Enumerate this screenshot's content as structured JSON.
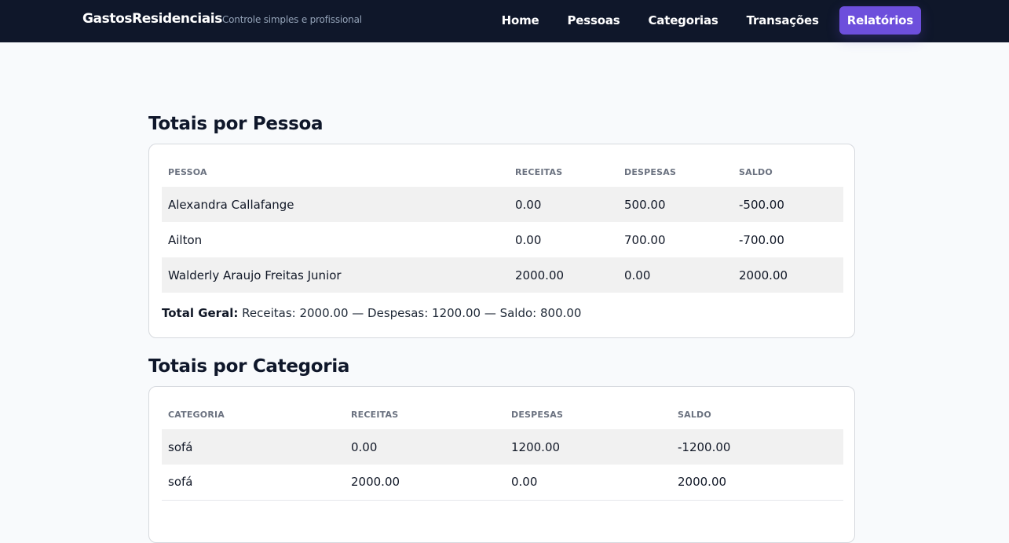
{
  "app": {
    "brand": "GastosResidenciais",
    "tagline": "Controle simples e profissional"
  },
  "nav": {
    "items": [
      {
        "label": "Home",
        "active": false
      },
      {
        "label": "Pessoas",
        "active": false
      },
      {
        "label": "Categorias",
        "active": false
      },
      {
        "label": "Transações",
        "active": false
      },
      {
        "label": "Relatórios",
        "active": true
      }
    ]
  },
  "colors": {
    "navbar_bg": "#0f172a",
    "accent": "#6d4fdc",
    "page_bg": "#f8fafc"
  },
  "pessoas": {
    "title": "Totais por Pessoa",
    "columns": [
      "PESSOA",
      "RECEITAS",
      "DESPESAS",
      "SALDO"
    ],
    "rows": [
      [
        "Alexandra Callafange",
        "0.00",
        "500.00",
        "-500.00"
      ],
      [
        "Ailton",
        "0.00",
        "700.00",
        "-700.00"
      ],
      [
        "Walderly Araujo Freitas Junior",
        "2000.00",
        "0.00",
        "2000.00"
      ]
    ],
    "total_label": "Total Geral:",
    "total_text": "Receitas: 2000.00 — Despesas: 1200.00 — Saldo: 800.00"
  },
  "categorias": {
    "title": "Totais por Categoria",
    "columns": [
      "CATEGORIA",
      "RECEITAS",
      "DESPESAS",
      "SALDO"
    ],
    "rows": [
      [
        "sofá",
        "0.00",
        "1200.00",
        "-1200.00"
      ],
      [
        "sofá",
        "2000.00",
        "0.00",
        "2000.00"
      ]
    ]
  }
}
